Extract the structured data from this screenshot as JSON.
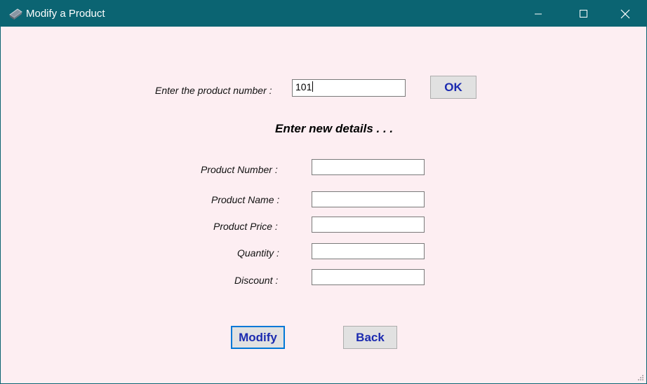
{
  "window": {
    "title": "Modify a Product",
    "app_icon": "product-icon",
    "controls": [
      "minimize-icon",
      "maximize-icon",
      "close-icon"
    ]
  },
  "lookup": {
    "label": "Enter the product number :",
    "value": "101",
    "ok_label": "OK"
  },
  "details": {
    "heading": "Enter new details . . .",
    "fields": [
      {
        "label": "Product Number :",
        "value": ""
      },
      {
        "label": "Product Name :",
        "value": ""
      },
      {
        "label": "Product Price :",
        "value": ""
      },
      {
        "label": "Quantity :",
        "value": ""
      },
      {
        "label": "Discount :",
        "value": ""
      }
    ]
  },
  "actions": {
    "modify_label": "Modify",
    "back_label": "Back"
  },
  "colors": {
    "titlebar": "#0b6472",
    "background": "#fdeef2",
    "button_text": "#1c2bb0",
    "default_button_border": "#0078d7"
  }
}
